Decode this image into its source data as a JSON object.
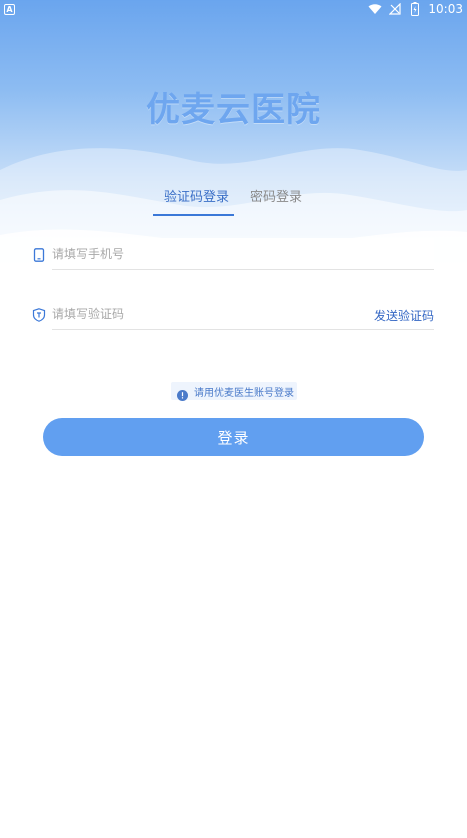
{
  "status_bar": {
    "left_indicator": "A",
    "time": "10:03",
    "icons": [
      "wifi-icon",
      "signal-off-icon",
      "battery-icon"
    ]
  },
  "app": {
    "title": "优麦云医院"
  },
  "tabs": [
    {
      "label": "验证码登录",
      "active": true
    },
    {
      "label": "密码登录",
      "active": false
    }
  ],
  "form": {
    "phone": {
      "placeholder": "请填写手机号",
      "value": "",
      "icon": "phone-icon"
    },
    "code": {
      "placeholder": "请填写验证码",
      "value": "",
      "icon": "shield-icon"
    },
    "send_code_label": "发送验证码"
  },
  "notice": {
    "icon": "info-icon",
    "text": "请用优麦医生账号登录"
  },
  "login_button": {
    "label": "登录"
  },
  "colors": {
    "accent": "#3b78d8",
    "button": "#619ff0",
    "title": "#6ea6ef",
    "link": "#3467c4"
  }
}
